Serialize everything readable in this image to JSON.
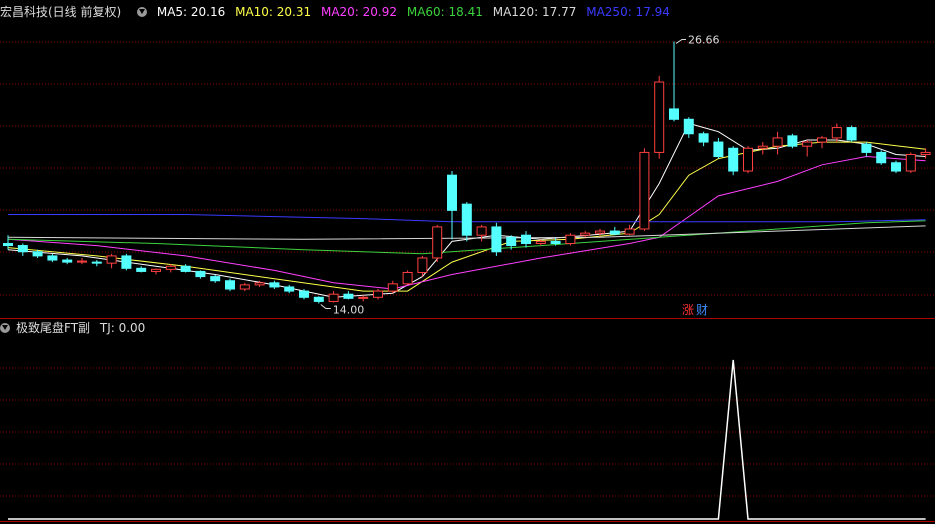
{
  "header": {
    "title": "宏昌科技(日线 前复权)",
    "ma": [
      {
        "label": "MA5: 20.16",
        "color": "#ffffff"
      },
      {
        "label": "MA10: 20.31",
        "color": "#ffff4a"
      },
      {
        "label": "MA20: 20.92",
        "color": "#ff40ff"
      },
      {
        "label": "MA60: 18.41",
        "color": "#3cd23c"
      },
      {
        "label": "MA120: 17.77",
        "color": "#d8d8d8"
      },
      {
        "label": "MA250: 17.94",
        "color": "#3a3aff"
      }
    ]
  },
  "sub": {
    "title": "极致尾盘FT副",
    "tj": "TJ: 0.00"
  },
  "badge": {
    "zhang": "涨",
    "cai": "财"
  },
  "colors": {
    "up": "#ff4040",
    "down": "#54ffff",
    "grid": "#8b0000",
    "axis": "#b00000"
  },
  "chart_data": [
    {
      "type": "candlestick",
      "ylim": [
        13.3,
        27.6
      ],
      "high_label": "26.66",
      "low_label": "14.00",
      "candles": [
        [
          16.9,
          17.3,
          16.6,
          16.8
        ],
        [
          16.8,
          16.9,
          16.3,
          16.5
        ],
        [
          16.5,
          16.6,
          16.2,
          16.3
        ],
        [
          16.3,
          16.4,
          16.0,
          16.1
        ],
        [
          16.1,
          16.2,
          15.9,
          16.0
        ],
        [
          16.0,
          16.2,
          15.9,
          16.05
        ],
        [
          16.0,
          16.1,
          15.8,
          15.95
        ],
        [
          15.95,
          16.4,
          15.7,
          16.3
        ],
        [
          16.3,
          16.4,
          15.6,
          15.7
        ],
        [
          15.7,
          15.8,
          15.5,
          15.55
        ],
        [
          15.55,
          15.7,
          15.4,
          15.65
        ],
        [
          15.65,
          15.9,
          15.5,
          15.8
        ],
        [
          15.8,
          15.9,
          15.5,
          15.55
        ],
        [
          15.55,
          15.6,
          15.2,
          15.3
        ],
        [
          15.3,
          15.4,
          15.0,
          15.1
        ],
        [
          15.1,
          15.2,
          14.6,
          14.7
        ],
        [
          14.7,
          15.0,
          14.6,
          14.9
        ],
        [
          14.9,
          15.1,
          14.8,
          15.0
        ],
        [
          15.0,
          15.1,
          14.7,
          14.8
        ],
        [
          14.8,
          14.9,
          14.5,
          14.6
        ],
        [
          14.6,
          14.7,
          14.2,
          14.3
        ],
        [
          14.3,
          14.35,
          14.0,
          14.1
        ],
        [
          14.1,
          14.6,
          14.05,
          14.45
        ],
        [
          14.45,
          14.6,
          14.2,
          14.25
        ],
        [
          14.25,
          14.4,
          14.1,
          14.3
        ],
        [
          14.3,
          14.7,
          14.2,
          14.6
        ],
        [
          14.6,
          15.1,
          14.5,
          14.95
        ],
        [
          14.95,
          15.6,
          14.9,
          15.5
        ],
        [
          15.5,
          16.3,
          15.3,
          16.2
        ],
        [
          16.2,
          17.8,
          16.0,
          17.7
        ],
        [
          20.2,
          20.4,
          17.1,
          18.5
        ],
        [
          18.8,
          18.9,
          17.0,
          17.3
        ],
        [
          17.3,
          17.8,
          17.0,
          17.7
        ],
        [
          17.7,
          17.9,
          16.3,
          16.5
        ],
        [
          17.2,
          17.3,
          16.6,
          16.8
        ],
        [
          17.3,
          17.5,
          16.7,
          16.9
        ],
        [
          16.9,
          17.1,
          16.8,
          17.0
        ],
        [
          17.0,
          17.15,
          16.8,
          16.9
        ],
        [
          16.9,
          17.4,
          16.8,
          17.3
        ],
        [
          17.3,
          17.5,
          17.2,
          17.4
        ],
        [
          17.4,
          17.6,
          17.3,
          17.5
        ],
        [
          17.5,
          17.7,
          17.3,
          17.35
        ],
        [
          17.35,
          17.8,
          17.3,
          17.6
        ],
        [
          17.6,
          21.5,
          17.5,
          21.3
        ],
        [
          21.3,
          25.0,
          21.0,
          24.7
        ],
        [
          23.4,
          26.66,
          22.8,
          22.9
        ],
        [
          22.9,
          23.0,
          22.0,
          22.2
        ],
        [
          22.2,
          22.3,
          21.6,
          21.8
        ],
        [
          21.8,
          22.0,
          21.0,
          21.1
        ],
        [
          21.5,
          21.6,
          20.2,
          20.4
        ],
        [
          20.4,
          21.6,
          20.3,
          21.5
        ],
        [
          21.5,
          21.8,
          21.2,
          21.6
        ],
        [
          21.6,
          22.3,
          21.2,
          22.0
        ],
        [
          22.1,
          22.2,
          21.5,
          21.6
        ],
        [
          21.6,
          21.9,
          21.1,
          21.8
        ],
        [
          21.8,
          22.1,
          21.5,
          22.0
        ],
        [
          22.0,
          22.7,
          21.8,
          22.5
        ],
        [
          22.5,
          22.6,
          21.8,
          21.9
        ],
        [
          21.7,
          21.8,
          21.1,
          21.3
        ],
        [
          21.3,
          21.4,
          20.7,
          20.8
        ],
        [
          20.8,
          20.9,
          20.3,
          20.4
        ],
        [
          20.4,
          21.3,
          20.3,
          21.2
        ],
        [
          21.2,
          21.5,
          21.0,
          21.3
        ]
      ],
      "ma": {
        "MA5": [
          [
            0,
            16.6
          ],
          [
            5,
            16.3
          ],
          [
            10,
            15.8
          ],
          [
            14,
            15.4
          ],
          [
            18,
            14.9
          ],
          [
            22,
            14.3
          ],
          [
            26,
            14.5
          ],
          [
            28,
            15.3
          ],
          [
            30,
            17.0
          ],
          [
            33,
            17.3
          ],
          [
            36,
            17.1
          ],
          [
            40,
            17.35
          ],
          [
            42,
            17.5
          ],
          [
            44,
            19.8
          ],
          [
            46,
            22.7
          ],
          [
            48,
            22.3
          ],
          [
            50,
            21.4
          ],
          [
            52,
            21.5
          ],
          [
            54,
            21.9
          ],
          [
            56,
            21.9
          ],
          [
            58,
            21.7
          ],
          [
            60,
            21.2
          ],
          [
            62,
            21.1
          ]
        ],
        "MA10": [
          [
            0,
            16.7
          ],
          [
            6,
            16.3
          ],
          [
            12,
            15.8
          ],
          [
            18,
            15.2
          ],
          [
            24,
            14.6
          ],
          [
            27,
            14.6
          ],
          [
            30,
            16.0
          ],
          [
            34,
            17.0
          ],
          [
            38,
            17.1
          ],
          [
            42,
            17.4
          ],
          [
            44,
            18.3
          ],
          [
            46,
            20.2
          ],
          [
            48,
            21.0
          ],
          [
            50,
            21.3
          ],
          [
            52,
            21.6
          ],
          [
            55,
            21.8
          ],
          [
            58,
            21.8
          ],
          [
            62,
            21.45
          ]
        ],
        "MA20": [
          [
            0,
            17.1
          ],
          [
            6,
            16.8
          ],
          [
            12,
            16.3
          ],
          [
            18,
            15.6
          ],
          [
            22,
            15.0
          ],
          [
            26,
            14.7
          ],
          [
            30,
            15.4
          ],
          [
            36,
            16.2
          ],
          [
            42,
            16.9
          ],
          [
            44,
            17.2
          ],
          [
            46,
            18.2
          ],
          [
            48,
            19.2
          ],
          [
            52,
            19.9
          ],
          [
            55,
            20.7
          ],
          [
            58,
            21.1
          ],
          [
            62,
            20.9
          ]
        ],
        "MA60": [
          [
            0,
            17.1
          ],
          [
            10,
            16.9
          ],
          [
            20,
            16.6
          ],
          [
            28,
            16.4
          ],
          [
            36,
            16.8
          ],
          [
            44,
            17.2
          ],
          [
            52,
            17.6
          ],
          [
            58,
            17.9
          ],
          [
            62,
            18.0
          ]
        ],
        "MA120": [
          [
            0,
            17.2
          ],
          [
            20,
            17.1
          ],
          [
            40,
            17.2
          ],
          [
            62,
            17.75
          ]
        ],
        "MA250": [
          [
            0,
            18.3
          ],
          [
            12,
            18.3
          ],
          [
            24,
            18.1
          ],
          [
            30,
            17.95
          ],
          [
            44,
            17.95
          ],
          [
            56,
            17.95
          ],
          [
            62,
            18.05
          ]
        ]
      }
    },
    {
      "type": "line",
      "name": "TJ",
      "ylim": [
        0,
        1.15
      ],
      "x_count": 63,
      "values": [
        0,
        0,
        0,
        0,
        0,
        0,
        0,
        0,
        0,
        0,
        0,
        0,
        0,
        0,
        0,
        0,
        0,
        0,
        0,
        0,
        0,
        0,
        0,
        0,
        0,
        0,
        0,
        0,
        0,
        0,
        0,
        0,
        0,
        0,
        0,
        0,
        0,
        0,
        0,
        0,
        0,
        0,
        0,
        0,
        0,
        0,
        0,
        0,
        0,
        1,
        0,
        0,
        0,
        0,
        0,
        0,
        0,
        0,
        0,
        0,
        0,
        0,
        0
      ]
    }
  ]
}
